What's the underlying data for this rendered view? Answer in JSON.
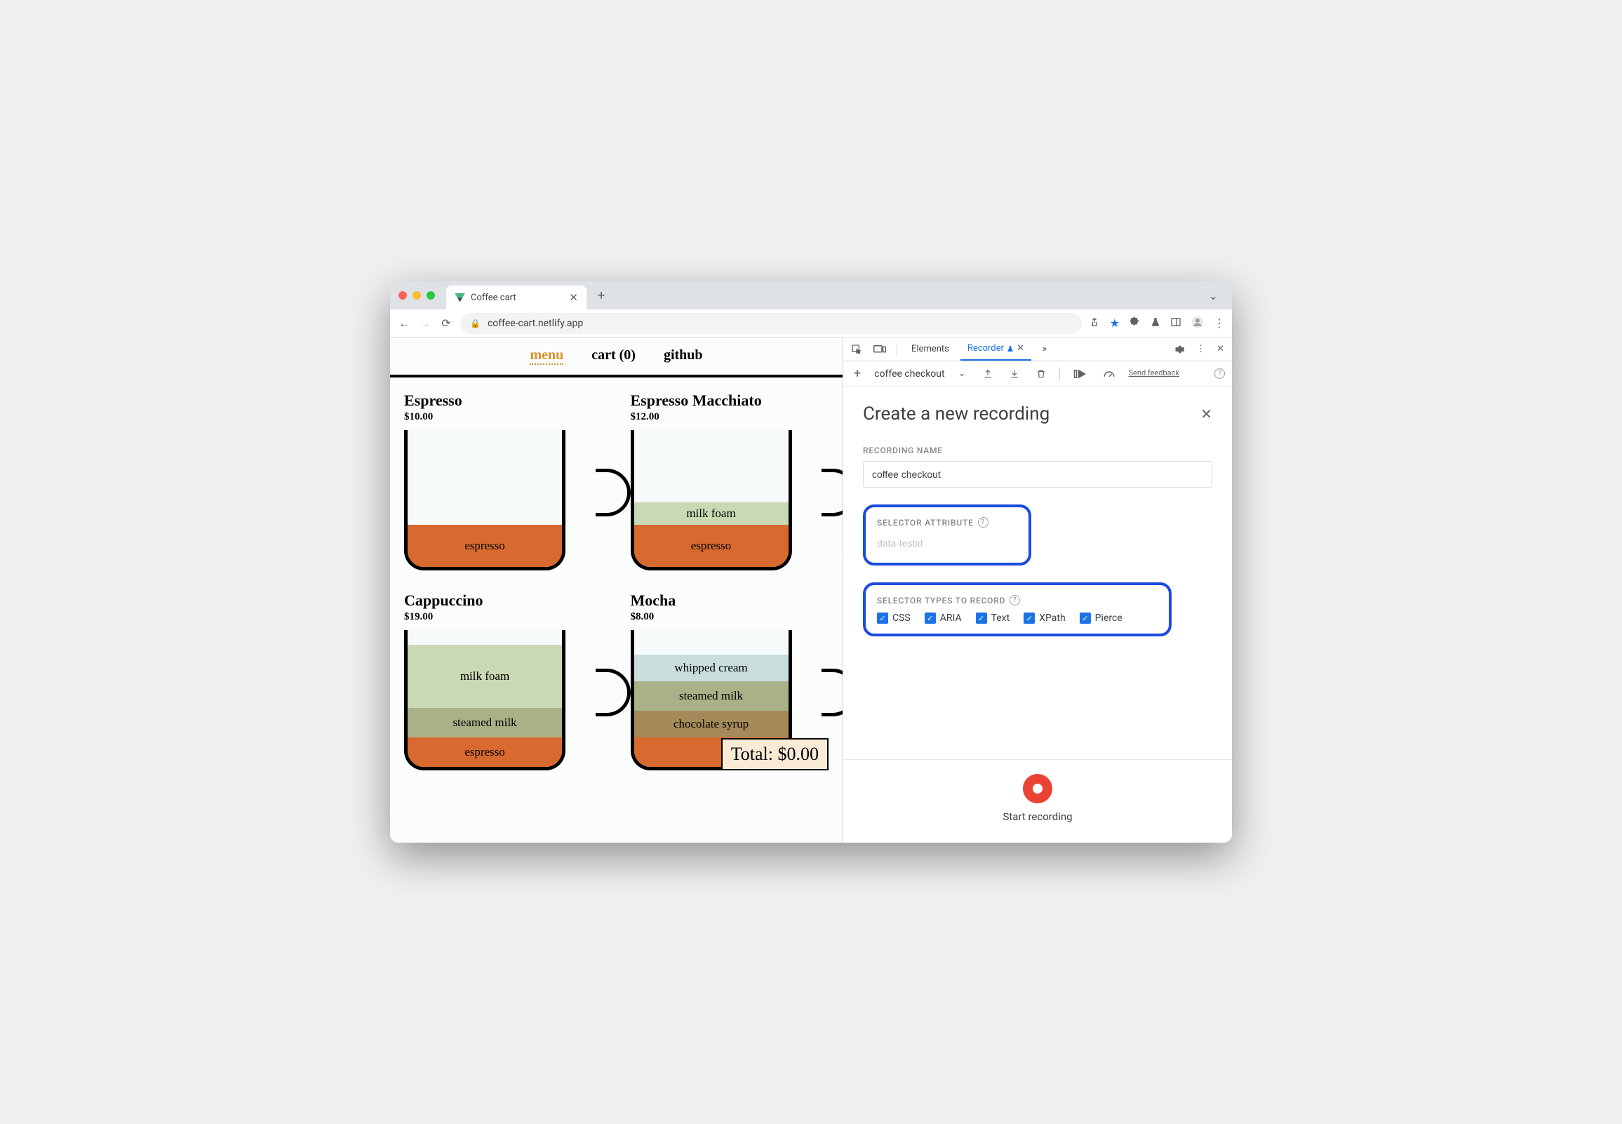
{
  "browser": {
    "tab_title": "Coffee cart",
    "url": "coffee-cart.netlify.app"
  },
  "page": {
    "nav": {
      "menu": "menu",
      "cart": "cart (0)",
      "github": "github"
    },
    "products": [
      {
        "name": "Espresso",
        "price": "$10.00"
      },
      {
        "name": "Espresso Macchiato",
        "price": "$12.00"
      },
      {
        "name": "Cappuccino",
        "price": "$19.00"
      },
      {
        "name": "Mocha",
        "price": "$8.00"
      }
    ],
    "layers": {
      "espresso": "espresso",
      "milk_foam": "milk foam",
      "steamed_milk": "steamed milk",
      "whipped_cream": "whipped cream",
      "chocolate_syrup": "chocolate syrup"
    },
    "total": "Total: $0.00"
  },
  "devtools": {
    "tabs": {
      "elements": "Elements",
      "recorder": "Recorder",
      "more": "»"
    },
    "toolbar": {
      "recording_name": "coffee checkout",
      "feedback": "Send feedback"
    },
    "panel": {
      "title": "Create a new recording",
      "recording_name_label": "RECORDING NAME",
      "recording_name_value": "coffee checkout",
      "selector_attr_label": "SELECTOR ATTRIBUTE",
      "selector_attr_placeholder": "data-testid",
      "selector_types_label": "SELECTOR TYPES TO RECORD",
      "selector_types": {
        "css": "CSS",
        "aria": "ARIA",
        "text": "Text",
        "xpath": "XPath",
        "pierce": "Pierce"
      },
      "start_label": "Start recording"
    }
  }
}
